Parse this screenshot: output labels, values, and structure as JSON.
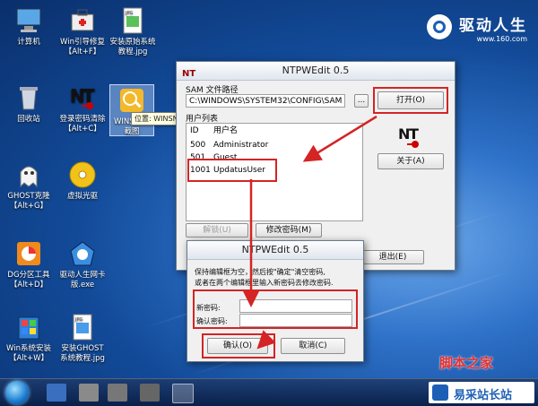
{
  "brand": {
    "title": "驱动人生",
    "url": "www.160.com"
  },
  "desktop_icons": [
    {
      "label1": "计算机",
      "label2": ""
    },
    {
      "label1": "Win引导修复",
      "label2": "【Alt+F】"
    },
    {
      "label1": "安装原始系统",
      "label2": "教程.jpg"
    },
    {
      "label1": "回收站",
      "label2": ""
    },
    {
      "label1": "登录密码清除",
      "label2": "【Alt+C】"
    },
    {
      "label1": "WINSNAP",
      "label2": "截图"
    },
    {
      "label1": "GHOST克隆",
      "label2": "【Alt+G】"
    },
    {
      "label1": "虚拟光驱",
      "label2": ""
    },
    {
      "label1": "DG分区工具",
      "label2": "【Alt+D】"
    },
    {
      "label1": "驱动人生网卡",
      "label2": "版.exe"
    },
    {
      "label1": "Win系统安装",
      "label2": "【Alt+W】"
    },
    {
      "label1": "安装GHOST",
      "label2": "系统教程.jpg"
    }
  ],
  "tooltip": "位置: WINSNAP (X:\\Program Files\\图形图像)",
  "main_window": {
    "title": "NTPWEdit 0.5",
    "sam_label": "SAM 文件路径",
    "sam_path": "C:\\WINDOWS\\SYSTEM32\\CONFIG\\SAM",
    "browse_label": "...",
    "open_label": "打开(O)",
    "users_label": "用户列表",
    "columns": {
      "id": "ID",
      "name": "用户名"
    },
    "users": [
      {
        "id": "500",
        "name": "Administrator"
      },
      {
        "id": "501",
        "name": "Guest"
      },
      {
        "id": "1001",
        "name": "UpdatusUser"
      }
    ],
    "about_label": "关于(A)",
    "unlock_label": "解锁(U)",
    "change_pw_label": "修改密码(M)",
    "exit_label": "退出(E)"
  },
  "dialog": {
    "title": "NTPWEdit 0.5",
    "hint_line1": "保持编辑框为空，然后按\"确定\"清空密码,",
    "hint_line2": "或者在两个编辑框里输入新密码去修改密码.",
    "new_pw_label": "新密码:",
    "confirm_pw_label": "确认密码:",
    "new_pw_value": "",
    "confirm_pw_value": "",
    "ok_label": "确认(O)",
    "cancel_label": "取消(C)"
  },
  "watermarks": {
    "site1": "脚本之家",
    "site2": "易采站长站"
  },
  "colors": {
    "highlight_red": "#d42424",
    "desktop_blue": "#1e5fb6"
  }
}
